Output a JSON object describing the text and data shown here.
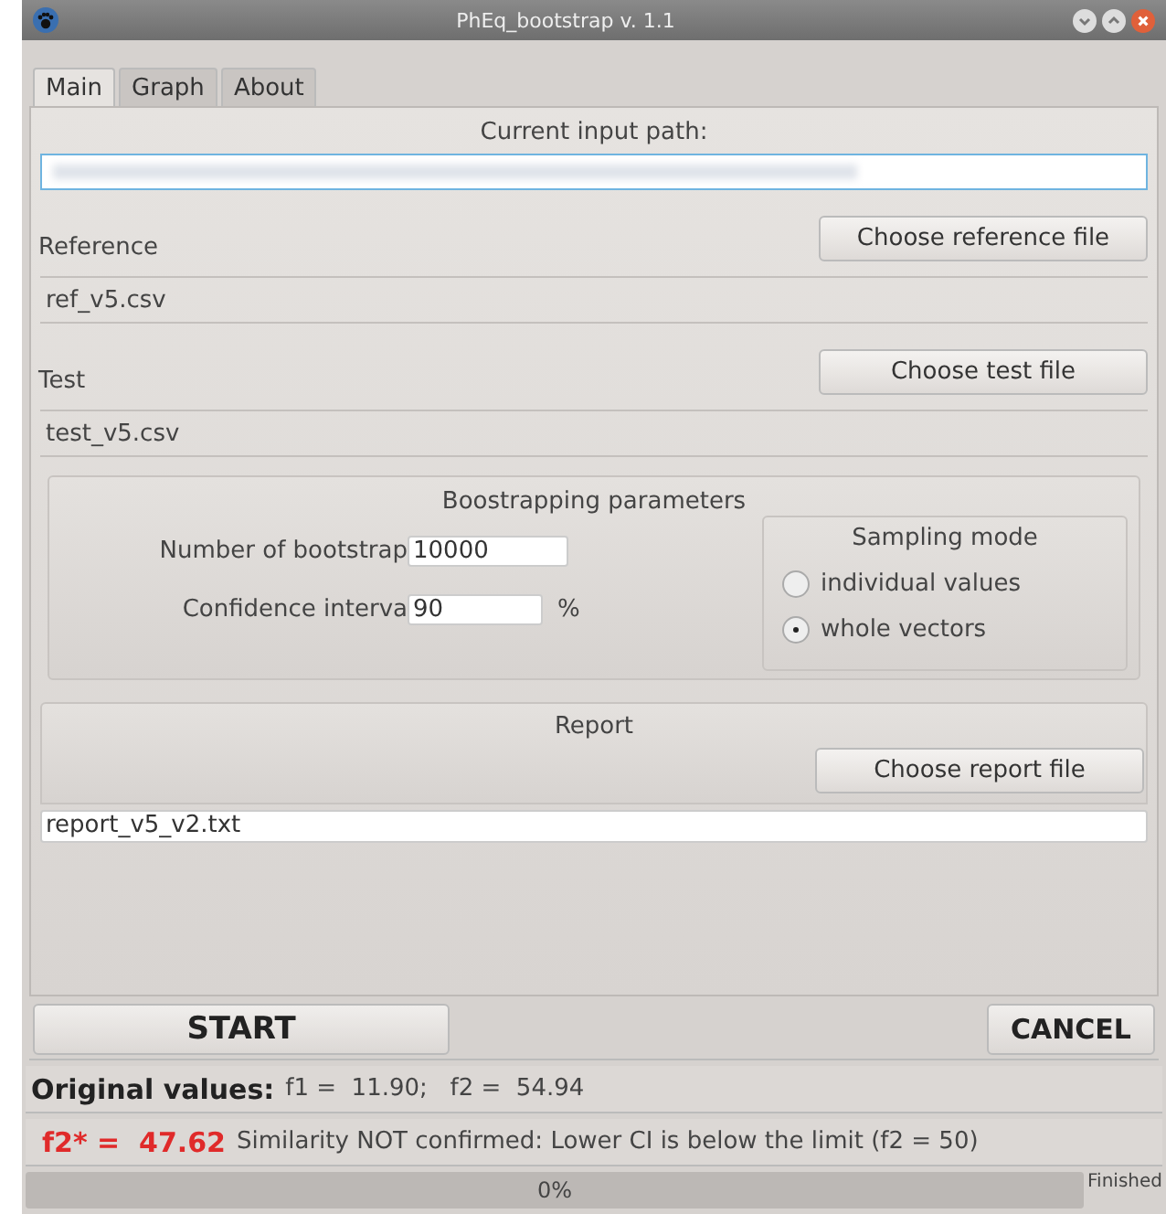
{
  "window": {
    "title": "PhEq_bootstrap v. 1.1"
  },
  "tabs": [
    {
      "label": "Main",
      "selected": true
    },
    {
      "label": "Graph",
      "selected": false
    },
    {
      "label": "About",
      "selected": false
    }
  ],
  "input_path": {
    "label": "Current input path:"
  },
  "reference": {
    "label": "Reference",
    "button": "Choose reference file",
    "value": "ref_v5.csv"
  },
  "test": {
    "label": "Test",
    "button": "Choose test file",
    "value": "test_v5.csv"
  },
  "parameters": {
    "title": "Boostrapping parameters",
    "bootstrap_label": "Number of bootstrap",
    "bootstrap_value": "10000",
    "ci_label": "Confidence interva",
    "ci_value": "90",
    "ci_unit": "%",
    "sampling": {
      "title": "Sampling mode",
      "options": [
        {
          "label": "individual values",
          "selected": false
        },
        {
          "label": "whole vectors",
          "selected": true
        }
      ]
    }
  },
  "report": {
    "title": "Report",
    "button": "Choose report file",
    "value": "report_v5_v2.txt"
  },
  "buttons": {
    "start": "START",
    "cancel": "CANCEL"
  },
  "original_values": {
    "label": "Original values:",
    "text": "f1 =  11.90;   f2 =  54.94"
  },
  "result": {
    "value": "f2* =  47.62",
    "message": "Similarity NOT confirmed: Lower CI is below the limit (f2 = 50)"
  },
  "progress": {
    "level": 0,
    "text": "0%",
    "status": "Finished"
  }
}
